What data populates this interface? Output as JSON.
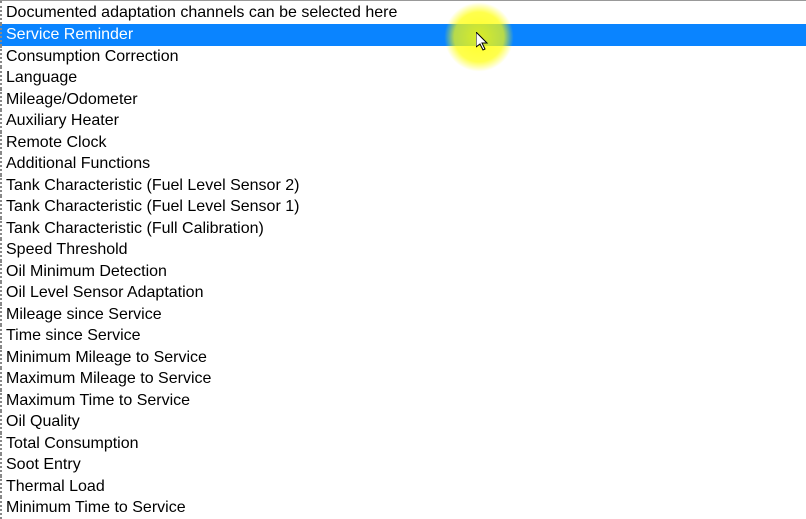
{
  "header": "Documented adaptation channels can be selected here",
  "selected_index": 0,
  "items": [
    "Service Reminder",
    "Consumption Correction",
    "Language",
    "Mileage/Odometer",
    "Auxiliary Heater",
    "Remote Clock",
    "Additional Functions",
    "Tank Characteristic (Fuel Level Sensor 2)",
    "Tank Characteristic (Fuel Level Sensor 1)",
    "Tank Characteristic (Full Calibration)",
    "Speed Threshold",
    "Oil Minimum Detection",
    "Oil Level Sensor Adaptation",
    "Mileage since Service",
    "Time since Service",
    "Minimum Mileage to Service",
    "Maximum Mileage to Service",
    "Maximum Time to Service",
    "Oil Quality",
    "Total Consumption",
    "Soot Entry",
    "Thermal Load",
    "Minimum Time to Service"
  ]
}
